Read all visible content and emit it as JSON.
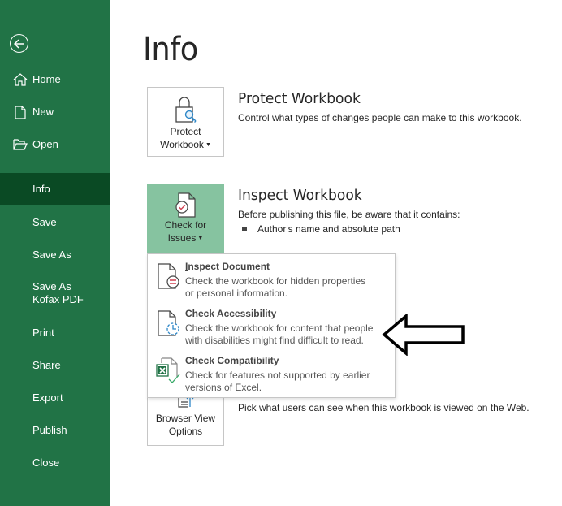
{
  "sidebar": {
    "back_icon": "back-arrow-circle-icon",
    "items": [
      {
        "label": "Home",
        "icon": "home-icon"
      },
      {
        "label": "New",
        "icon": "new-document-icon"
      },
      {
        "label": "Open",
        "icon": "folder-open-icon"
      },
      {
        "label": "Info"
      },
      {
        "label": "Save"
      },
      {
        "label": "Save As"
      },
      {
        "label": "Save As Kofax PDF"
      },
      {
        "label": "Print"
      },
      {
        "label": "Share"
      },
      {
        "label": "Export"
      },
      {
        "label": "Publish"
      },
      {
        "label": "Close"
      }
    ],
    "active": "Info",
    "colors": {
      "background": "#217346",
      "active": "#0a4a24"
    }
  },
  "main": {
    "title": "Info",
    "protect": {
      "button_line1": "Protect",
      "button_line2": "Workbook",
      "title": "Protect Workbook",
      "description": "Control what types of changes people can make to this workbook."
    },
    "inspect": {
      "button_line1": "Check for",
      "button_line2": "Issues",
      "title": "Inspect Workbook",
      "description": "Before publishing this file, be aware that it contains:",
      "bullets": [
        "Author's name and absolute path"
      ]
    },
    "browser_view": {
      "button_line1": "Browser View",
      "button_line2": "Options",
      "description": "Pick what users can see when this workbook is viewed on the Web."
    }
  },
  "check_menu": {
    "items": [
      {
        "title_pre": "",
        "title_key": "I",
        "title_post": "nspect Document",
        "desc_line1": "Check the workbook for hidden properties",
        "desc_line2": "or personal information."
      },
      {
        "title_pre": "Check ",
        "title_key": "A",
        "title_post": "ccessibility",
        "desc_line1": "Check the workbook for content that people",
        "desc_line2": "with disabilities might find difficult to read."
      },
      {
        "title_pre": "Check ",
        "title_key": "C",
        "title_post": "ompatibility",
        "desc_line1": "Check for features not supported by earlier",
        "desc_line2": "versions of Excel."
      }
    ]
  },
  "annotation": {
    "icon": "left-arrow-annotation-icon"
  }
}
